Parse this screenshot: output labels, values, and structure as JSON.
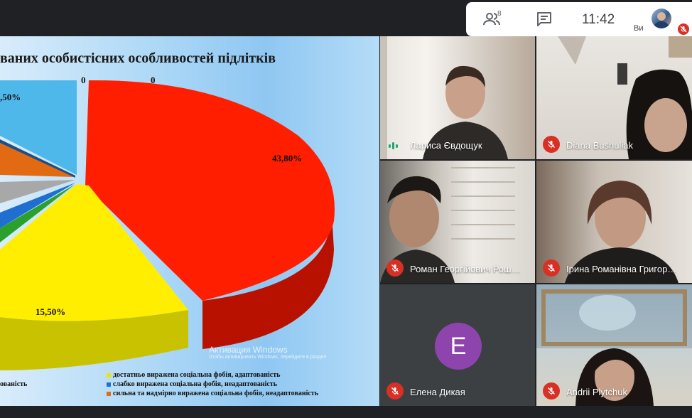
{
  "top_bar": {
    "people_count": "8",
    "clock": "11:42",
    "self_label": "Ви",
    "people_icon": "people-icon",
    "chat_icon": "chat-icon"
  },
  "slide": {
    "title": "ваних особистісних особливостей підлітків",
    "zero_labels": [
      "0",
      "0"
    ],
    "watermark_title": "Активация Windows",
    "watermark_sub": "Чтобы активировать Windows, перейдите в раздел",
    "legend": [
      {
        "label": "достатньо виражена соціальна фобія, адаптованість",
        "color": "#f2e200"
      },
      {
        "label": "слабко виражена соціальна фобія, неадаптованість",
        "color": "#1f6fd0"
      },
      {
        "label": "сильна та надмірно виражена соціальна фобія, неадаптованість",
        "color": "#e26a12"
      },
      {
        "label": "ованість",
        "color": "#000000"
      }
    ]
  },
  "chart_data": {
    "type": "pie",
    "title": "",
    "slices": [
      {
        "label": "",
        "value": 43.8,
        "color": "#ff1a00",
        "data_label": "43,80%"
      },
      {
        "label": "достатньо виражена соціальна фобія, адаптованість",
        "value": 15.5,
        "color": "#ffee00",
        "data_label": "15,50%"
      },
      {
        "label": "",
        "value": null,
        "color": "#46b3e6",
        "data_label": ",50%"
      },
      {
        "label": "",
        "value": 0,
        "color": "",
        "data_label": "0"
      },
      {
        "label": "",
        "value": 0,
        "color": "",
        "data_label": "0"
      }
    ],
    "partially_visible": true
  },
  "participants": [
    {
      "name": "Лариса Євдощук",
      "muted": false,
      "speaking": true
    },
    {
      "name": "Diana Bushuliak",
      "muted": true,
      "speaking": false
    },
    {
      "name": "Роман Георгійович Рош…",
      "muted": true,
      "speaking": false
    },
    {
      "name": "Ірина Романівна Григор…",
      "muted": true,
      "speaking": false
    },
    {
      "name": "Елена Дикая",
      "muted": true,
      "speaking": false,
      "avatar_letter": "E",
      "avatar_color": "#8e44ad"
    },
    {
      "name": "Andrii Plytchuk",
      "muted": true,
      "speaking": false
    }
  ],
  "colors": {
    "background": "#202124",
    "mic_off": "#d93025",
    "speaking": "#1ea672"
  }
}
